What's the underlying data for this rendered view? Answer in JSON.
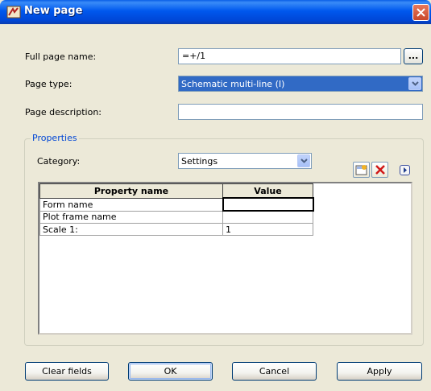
{
  "window": {
    "title": "New page",
    "close_icon": "close-icon",
    "app_icon": "app-icon",
    "titlebar_color": "#0054E3"
  },
  "fields": {
    "full_page_name": {
      "label": "Full page name:",
      "value": "=+/1",
      "browse_label": "..."
    },
    "page_type": {
      "label": "Page type:",
      "value": "Schematic multi-line (I)"
    },
    "page_description": {
      "label": "Page description:",
      "value": ""
    }
  },
  "properties": {
    "legend": "Properties",
    "category_label": "Category:",
    "category_value": "Settings",
    "toolbar": [
      "new-property-icon",
      "delete-property-icon",
      "expand-arrow-icon"
    ],
    "columns": [
      "Property name",
      "Value"
    ],
    "rows": [
      {
        "name": "Form name",
        "value": ""
      },
      {
        "name": "Plot frame name",
        "value": ""
      },
      {
        "name": "Scale 1:",
        "value": "1"
      }
    ]
  },
  "buttons": {
    "clear_fields": "Clear fields",
    "ok": "OK",
    "cancel": "Cancel",
    "apply": "Apply"
  },
  "colors": {
    "selection": "#316AC5",
    "dialog_bg": "#ECE9D8",
    "legend": "#0046D5"
  }
}
